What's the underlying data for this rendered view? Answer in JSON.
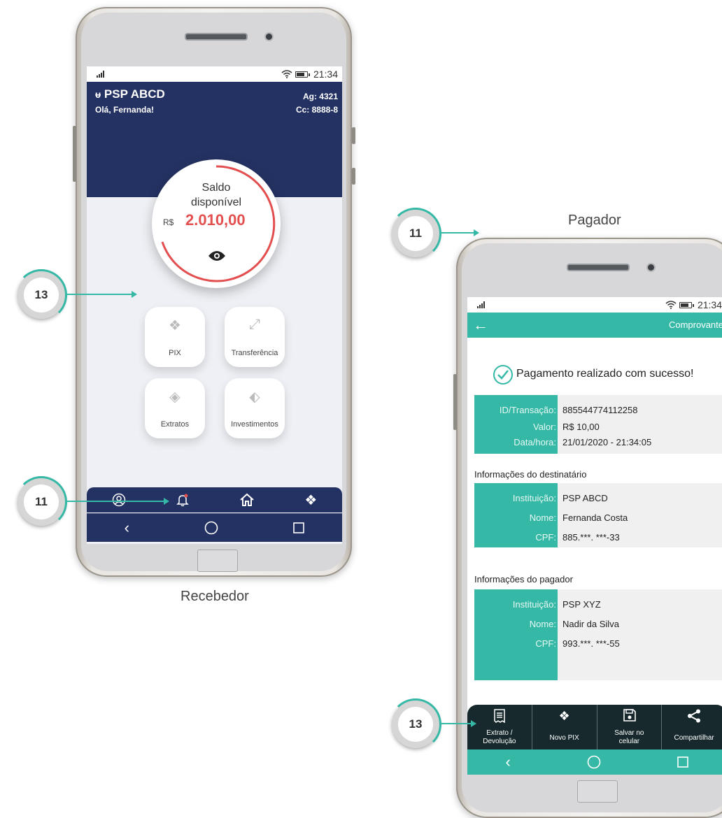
{
  "receiver": {
    "caption": "Recebedor",
    "status_time": "21:34",
    "bank_name": "PSP ABCD",
    "greeting": "Olá, Fernanda!",
    "agency": "Ag: 4321",
    "account": "Cc: 8888-8",
    "balance": {
      "title_line1": "Saldo",
      "title_line2": "disponível",
      "currency": "R$",
      "value": "2.010,00"
    },
    "tiles": [
      {
        "label": "PIX",
        "icon": "pix-icon"
      },
      {
        "label": "Transferência",
        "icon": "transfer-icon"
      },
      {
        "label": "Extratos",
        "icon": "statement-icon"
      },
      {
        "label": "Investimentos",
        "icon": "investment-icon"
      }
    ],
    "bottom_nav_icons": [
      "profile-icon",
      "bell-icon",
      "home-icon",
      "pix-icon"
    ]
  },
  "payer": {
    "caption": "Pagador",
    "status_time": "21:34",
    "header_title": "Comprovante",
    "success_message": "Pagamento realizado com sucesso!",
    "transaction": {
      "id_label": "ID/Transação:",
      "id_value": "885544774112258",
      "value_label": "Valor:",
      "value_value": "R$ 10,00",
      "date_label": "Data/hora:",
      "date_value": "21/01/2020 - 21:34:05"
    },
    "recipient": {
      "section_title": "Informações do destinatário",
      "institution_label": "Instituição:",
      "institution_value": "PSP ABCD",
      "name_label": "Nome:",
      "name_value": "Fernanda Costa",
      "cpf_label": "CPF:",
      "cpf_value": "885.***. ***-33"
    },
    "payer_info": {
      "section_title": "Informações do pagador",
      "institution_label": "Instituição:",
      "institution_value": "PSP XYZ",
      "name_label": "Nome:",
      "name_value": "Nadir da Silva",
      "cpf_label": "CPF:",
      "cpf_value": "993.***. ***-55"
    },
    "actions": [
      {
        "label_line1": "Extrato /",
        "label_line2": "Devolução",
        "icon": "receipt-icon"
      },
      {
        "label_line1": "Novo PIX",
        "label_line2": "",
        "icon": "pix-icon"
      },
      {
        "label_line1": "Salvar no",
        "label_line2": "celular",
        "icon": "save-icon"
      },
      {
        "label_line1": "Compartilhar",
        "label_line2": "",
        "icon": "share-icon"
      }
    ]
  },
  "callouts": [
    {
      "number": "13"
    },
    {
      "number": "11"
    },
    {
      "number": "11"
    },
    {
      "number": "13"
    }
  ],
  "colors": {
    "navy": "#243263",
    "teal": "#35b9a6",
    "balance_red": "#e34e4e",
    "dark_action_bar": "#17292c"
  }
}
